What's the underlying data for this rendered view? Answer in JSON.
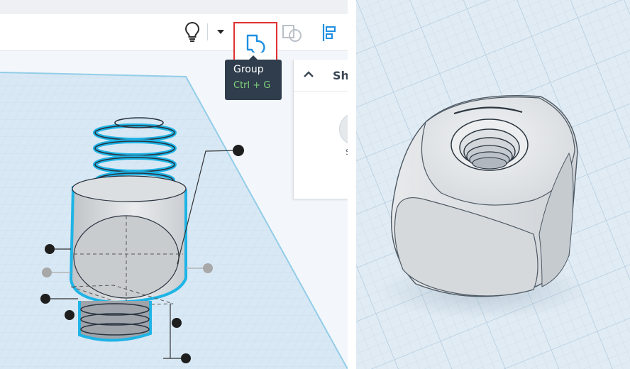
{
  "toolbar": {
    "tooltip": {
      "title": "Group",
      "shortcut": "Ctrl + G"
    }
  },
  "shape_panel": {
    "title": "Sha",
    "swatch_label": "S"
  },
  "colors": {
    "accent_blue": "#1d8fe1",
    "highlight_red": "#e03131",
    "tooltip_bg": "#2f3d4c",
    "shortcut_green": "#7fd07a",
    "selection_cyan": "#1eb4e6",
    "grid_line": "#bcd4e6"
  },
  "icons": [
    "lightbulb-icon",
    "dropdown-caret-icon",
    "group-icon",
    "ungroup-icon",
    "align-icon",
    "chevron-up-icon"
  ]
}
